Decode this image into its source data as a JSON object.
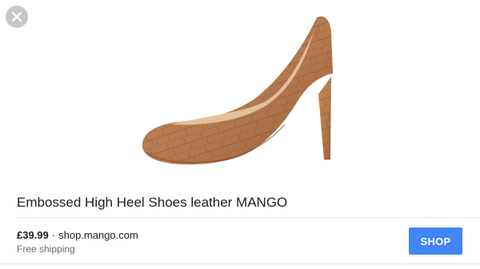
{
  "product": {
    "title": "Embossed High Heel Shoes leather MANGO",
    "price": "£39.99",
    "separator": "·",
    "store": "shop.mango.com",
    "shipping": "Free shipping",
    "image_icon": "brown-croc-embossed-pump"
  },
  "actions": {
    "shop_label": "SHOP",
    "close_icon": "close-icon"
  },
  "colors": {
    "accent": "#4285f4",
    "close_bg": "#c9c9c9",
    "shoe_leather": "#b4794e"
  }
}
